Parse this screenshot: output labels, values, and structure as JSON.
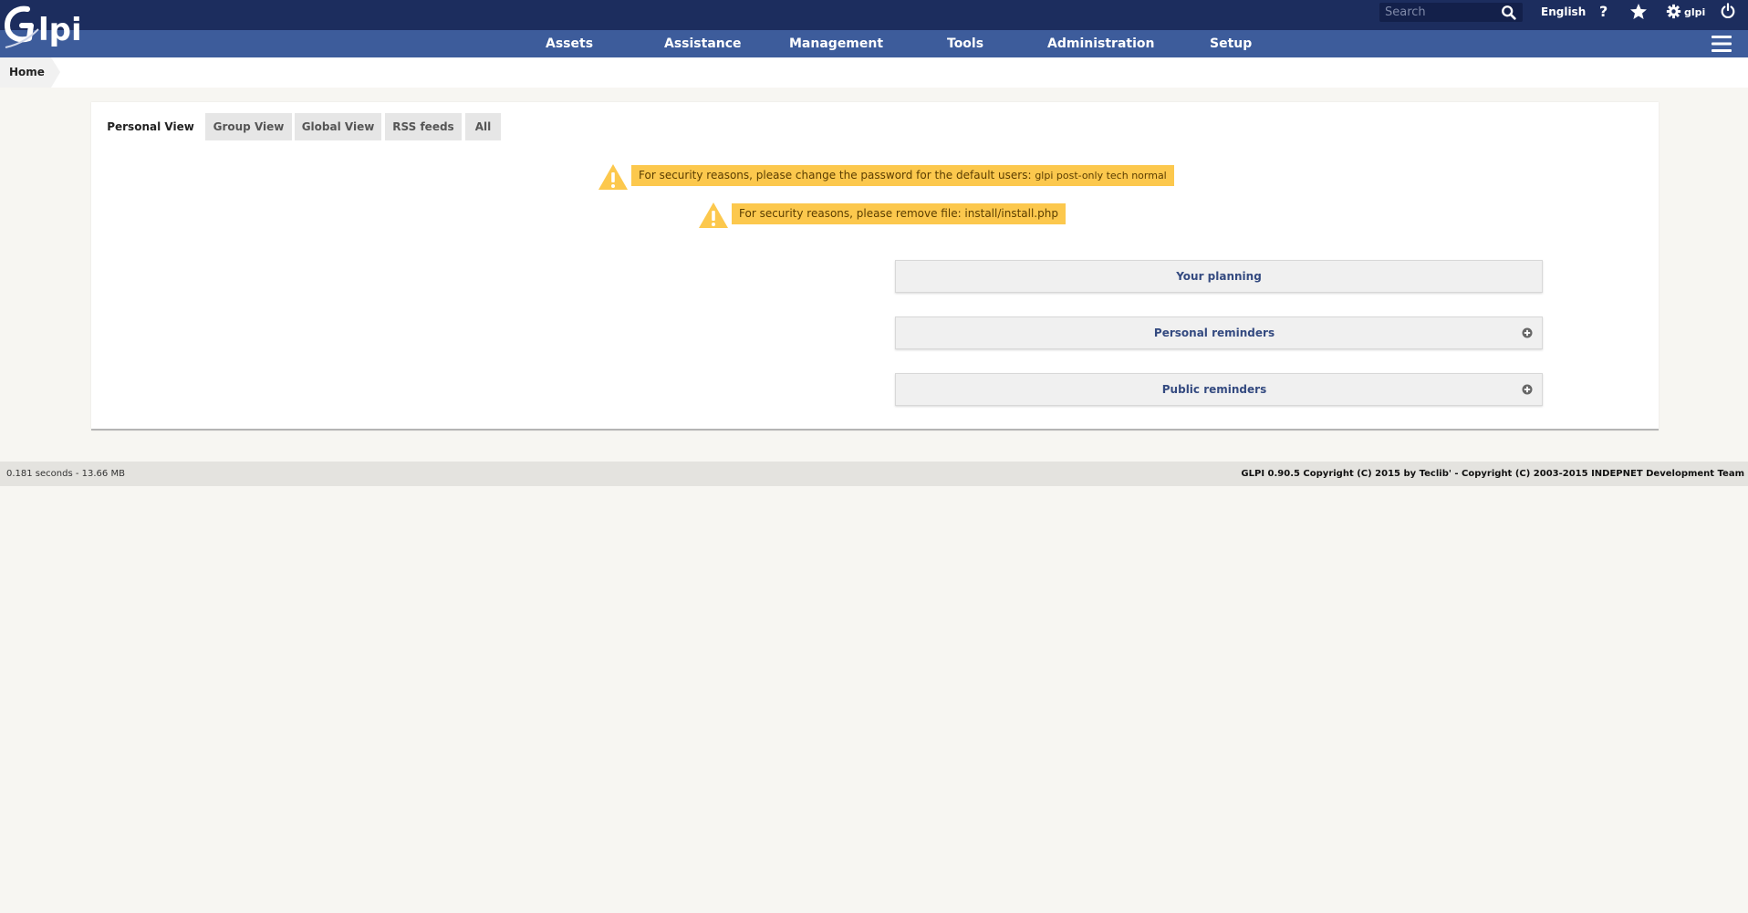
{
  "header": {
    "logo_text": "Glpi",
    "search_placeholder": "Search",
    "language": "English",
    "help_label": "?",
    "user": "glpi"
  },
  "nav": {
    "items": [
      "Assets",
      "Assistance",
      "Management",
      "Tools",
      "Administration",
      "Setup"
    ]
  },
  "breadcrumb": {
    "home": "Home"
  },
  "tabs": [
    "Personal View",
    "Group View",
    "Global View",
    "RSS feeds",
    "All"
  ],
  "warnings": {
    "w1_text": "For security reasons, please change the password for the default users: ",
    "w1_users": "glpi post-only tech normal",
    "w2_text": "For security reasons, please remove file: install/install.php"
  },
  "widgets": {
    "planning": "Your planning",
    "personal_reminders": "Personal reminders",
    "public_reminders": "Public reminders"
  },
  "footer": {
    "stats": "0.181 seconds - 13.66 MB",
    "copyright": "GLPI 0.90.5 Copyright (C) 2015 by Teclib' - Copyright (C) 2003-2015 INDEPNET Development Team"
  },
  "colors": {
    "topbar": "#1c2d5e",
    "navbar": "#3d5c9b",
    "warning": "#fcc84d",
    "background": "#f7f6f2"
  }
}
